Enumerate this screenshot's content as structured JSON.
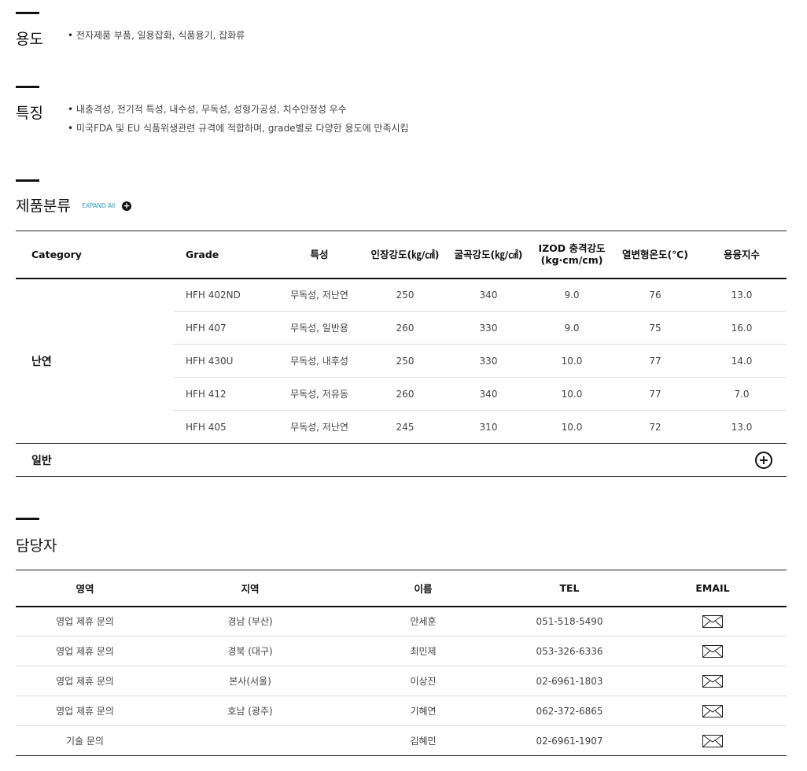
{
  "usage": {
    "title": "용도",
    "items": [
      "전자제품 부품, 일용잡화, 식품용기, 잡화류"
    ]
  },
  "features": {
    "title": "특징",
    "items": [
      "내충격성, 전기적 특성, 내수성, 무독성, 성형가공성, 치수안정성 우수",
      "미국FDA 및 EU 식품위생관련 규격에 적합하며, grade별로 다양한 용도에 만족시킴"
    ]
  },
  "products": {
    "title": "제품분류",
    "expand_label": "EXPAND All",
    "headers": [
      "Category",
      "Grade",
      "특성",
      "인장강도(㎏/㎠)",
      "굴곡강도(㎏/㎠)",
      "IZOD 충격강도",
      "(kg·cm/cm)",
      "열변형온도(℃)",
      "용융지수"
    ],
    "category_name": "난연",
    "rows": [
      [
        "HFH 402ND",
        "무독성, 저난연",
        "250",
        "340",
        "9.0",
        "76",
        "13.0"
      ],
      [
        "HFH 407",
        "무독성, 일반용",
        "260",
        "330",
        "9.0",
        "75",
        "16.0"
      ],
      [
        "HFH 430U",
        "무독성, 내후성",
        "250",
        "330",
        "10.0",
        "77",
        "14.0"
      ],
      [
        "HFH 412",
        "무독성, 저유동",
        "260",
        "340",
        "10.0",
        "77",
        "7.0"
      ],
      [
        "HFH 405",
        "무독성, 저난연",
        "245",
        "310",
        "10.0",
        "72",
        "13.0"
      ]
    ],
    "collapsed_category": "일반"
  },
  "contacts": {
    "title": "담당자",
    "headers": [
      "영역",
      "지역",
      "이름",
      "TEL",
      "EMAIL"
    ],
    "rows": [
      [
        "영업 제휴 문의",
        "경남 (부산)",
        "안세훈",
        "051-518-5490"
      ],
      [
        "영업 제휴 문의",
        "경북 (대구)",
        "최민제",
        "053-326-6336"
      ],
      [
        "영업 제휴 문의",
        "본사(서울)",
        "이상진",
        "02-6961-1803"
      ],
      [
        "영업 제휴 문의",
        "호남 (광주)",
        "기혜연",
        "062-372-6865"
      ],
      [
        "기술 문의",
        "",
        "김혜민",
        "02-6961-1907"
      ]
    ]
  }
}
